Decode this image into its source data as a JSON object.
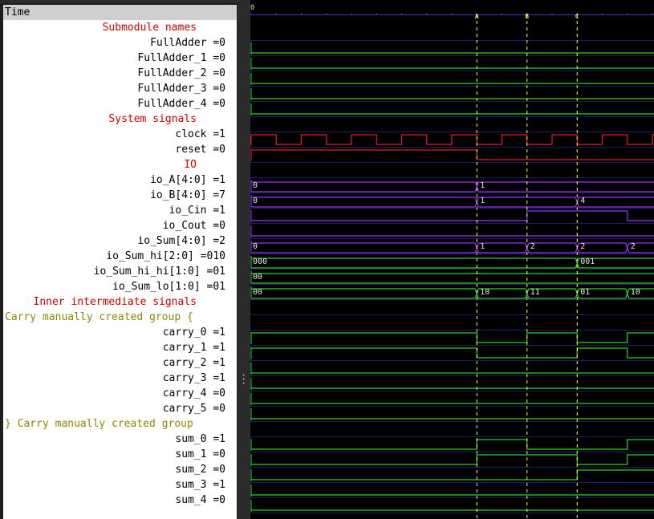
{
  "header": {
    "time_label": "Time",
    "time_zero": "0"
  },
  "markers": [
    {
      "label": "A"
    },
    {
      "label": "B"
    },
    {
      "label": "C"
    }
  ],
  "rows": [
    {
      "kind": "section",
      "text": "Submodule names"
    },
    {
      "kind": "signal",
      "text": "FullAdder =0",
      "wave": {
        "type": "bit",
        "trans": [],
        "init": 0,
        "color": "#2ed12e"
      }
    },
    {
      "kind": "signal",
      "text": "FullAdder_1 =0",
      "wave": {
        "type": "bit",
        "trans": [],
        "init": 0,
        "color": "#2ed12e"
      }
    },
    {
      "kind": "signal",
      "text": "FullAdder_2 =0",
      "wave": {
        "type": "bit",
        "trans": [],
        "init": 0,
        "color": "#2ed12e"
      }
    },
    {
      "kind": "signal",
      "text": "FullAdder_3 =0",
      "wave": {
        "type": "bit",
        "trans": [],
        "init": 0,
        "color": "#2ed12e"
      }
    },
    {
      "kind": "signal",
      "text": "FullAdder_4 =0",
      "wave": {
        "type": "bit",
        "trans": [],
        "init": 0,
        "color": "#2ed12e"
      }
    },
    {
      "kind": "section",
      "text": "System signals"
    },
    {
      "kind": "signal",
      "text": "clock =1",
      "wave": {
        "type": "clock",
        "color": "#e02020"
      }
    },
    {
      "kind": "signal",
      "text": "reset =0",
      "wave": {
        "type": "bit",
        "trans": [
          4.5
        ],
        "init": 1,
        "color": "#e02020"
      }
    },
    {
      "kind": "section",
      "text": "IO"
    },
    {
      "kind": "signal",
      "text": "io_A[4:0] =1",
      "wave": {
        "type": "bus",
        "color": "#9b30ff",
        "segs": [
          {
            "t": 0,
            "v": "0"
          },
          {
            "t": 4.5,
            "v": "1"
          }
        ]
      }
    },
    {
      "kind": "signal",
      "text": "io_B[4:0] =7",
      "wave": {
        "type": "bus",
        "color": "#9b30ff",
        "segs": [
          {
            "t": 0,
            "v": "0"
          },
          {
            "t": 4.5,
            "v": "1"
          },
          {
            "t": 6.5,
            "v": "4"
          }
        ]
      }
    },
    {
      "kind": "signal",
      "text": "io_Cin =1",
      "wave": {
        "type": "bit",
        "trans": [
          5.5,
          7.5
        ],
        "init": 0,
        "color": "#9b30ff"
      }
    },
    {
      "kind": "signal",
      "text": "io_Cout =0",
      "wave": {
        "type": "bit",
        "trans": [],
        "init": 0,
        "color": "#9b30ff"
      }
    },
    {
      "kind": "signal",
      "text": "io_Sum[4:0] =2",
      "wave": {
        "type": "bus",
        "color": "#9b30ff",
        "segs": [
          {
            "t": 0,
            "v": "0"
          },
          {
            "t": 4.5,
            "v": "1"
          },
          {
            "t": 5.5,
            "v": "2"
          },
          {
            "t": 6.5,
            "v": "2"
          },
          {
            "t": 7.5,
            "v": "2"
          }
        ]
      }
    },
    {
      "kind": "signal",
      "text": "io_Sum_hi[2:0] =010",
      "wave": {
        "type": "bus",
        "color": "#2ed12e",
        "segs": [
          {
            "t": 0,
            "v": "000"
          },
          {
            "t": 6.5,
            "v": "001"
          }
        ]
      }
    },
    {
      "kind": "signal",
      "text": "io_Sum_hi_hi[1:0] =01",
      "wave": {
        "type": "bus",
        "color": "#2ed12e",
        "segs": [
          {
            "t": 0,
            "v": "00"
          }
        ]
      }
    },
    {
      "kind": "signal",
      "text": "io_Sum_lo[1:0] =01",
      "wave": {
        "type": "bus",
        "color": "#2ed12e",
        "segs": [
          {
            "t": 0,
            "v": "00"
          },
          {
            "t": 4.5,
            "v": "10"
          },
          {
            "t": 5.5,
            "v": "11"
          },
          {
            "t": 6.5,
            "v": "01"
          },
          {
            "t": 7.5,
            "v": "10"
          }
        ]
      }
    },
    {
      "kind": "section",
      "text": "Inner intermediate signals"
    },
    {
      "kind": "group",
      "text": "Carry manually created group {"
    },
    {
      "kind": "signal",
      "text": "carry_0 =1",
      "wave": {
        "type": "bit",
        "trans": [
          4.5,
          5.5,
          6.5,
          7.5
        ],
        "init": 1,
        "color": "#2ed12e"
      }
    },
    {
      "kind": "signal",
      "text": "carry_1 =1",
      "wave": {
        "type": "bit",
        "trans": [
          4.5,
          6.5,
          7.5
        ],
        "init": 1,
        "color": "#2ed12e"
      }
    },
    {
      "kind": "signal",
      "text": "carry_2 =1",
      "wave": {
        "type": "bit",
        "trans": [],
        "init": 0,
        "color": "#2ed12e"
      }
    },
    {
      "kind": "signal",
      "text": "carry_3 =1",
      "wave": {
        "type": "bit",
        "trans": [],
        "init": 0,
        "color": "#2ed12e"
      }
    },
    {
      "kind": "signal",
      "text": "carry_4 =0",
      "wave": {
        "type": "bit",
        "trans": [],
        "init": 0,
        "color": "#2ed12e"
      }
    },
    {
      "kind": "signal",
      "text": "carry_5 =0",
      "wave": {
        "type": "bit",
        "trans": [],
        "init": 0,
        "color": "#2ed12e"
      }
    },
    {
      "kind": "group",
      "text": "} Carry manually created group"
    },
    {
      "kind": "signal",
      "text": "sum_0 =1",
      "wave": {
        "type": "bit",
        "trans": [
          4.5,
          5.5,
          7.5
        ],
        "init": 0,
        "color": "#2ed12e"
      }
    },
    {
      "kind": "signal",
      "text": "sum_1 =0",
      "wave": {
        "type": "bit",
        "trans": [
          4.5,
          6.5,
          7.5
        ],
        "init": 0,
        "color": "#2ed12e"
      }
    },
    {
      "kind": "signal",
      "text": "sum_2 =0",
      "wave": {
        "type": "bit",
        "trans": [
          6.5
        ],
        "init": 0,
        "color": "#2ed12e"
      }
    },
    {
      "kind": "signal",
      "text": "sum_3 =1",
      "wave": {
        "type": "bit",
        "trans": [],
        "init": 0,
        "color": "#2ed12e"
      }
    },
    {
      "kind": "signal",
      "text": "sum_4 =0",
      "wave": {
        "type": "bit",
        "trans": [],
        "init": 0,
        "color": "#2ed12e"
      }
    }
  ]
}
